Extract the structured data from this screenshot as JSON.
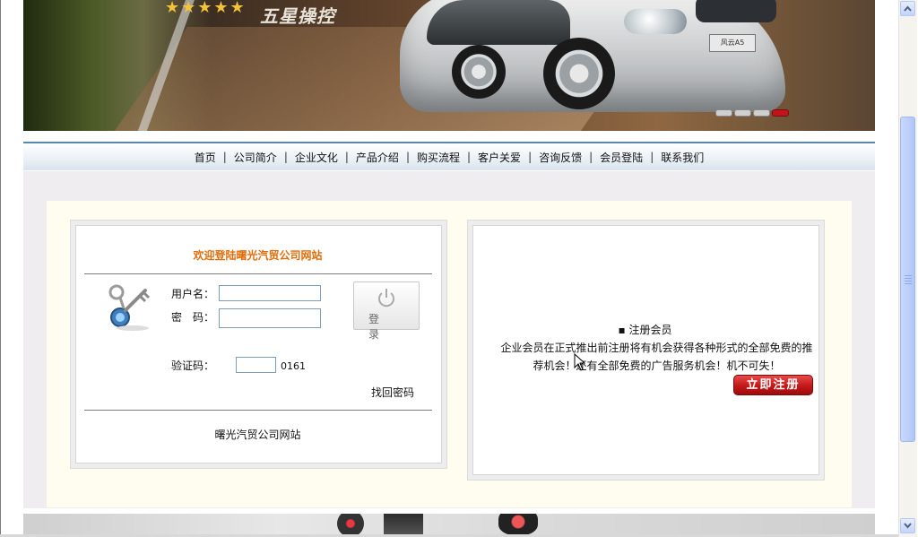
{
  "banner": {
    "stars": "★★★★★",
    "slogan": "五星操控",
    "plate_text": "风云A5",
    "slides_total": 4,
    "active_slide": 4
  },
  "nav": {
    "items": [
      "首页",
      "公司简介",
      "企业文化",
      "产品介绍",
      "购买流程",
      "客户关爱",
      "咨询反馈",
      "会员登陆",
      "联系我们"
    ]
  },
  "login": {
    "welcome": "欢迎登陆曙光汽贸公司网站",
    "username_label": "用户名：",
    "password_label": "密　码：",
    "captcha_label": "验证码：",
    "captcha_code": "0161",
    "username_value": "",
    "password_value": "",
    "captcha_value": "",
    "login_button": "登录",
    "find_password": "找回密码",
    "footer_site": "曙光汽贸公司网站"
  },
  "register": {
    "title": "▪ 注册会员",
    "text": "企业会员在正式推出前注册将有机会获得各种形式的全部免费的推荐机会！还有全部免费的广告服务机会！机不可失！",
    "button": "立即注册"
  },
  "colors": {
    "welcome_text": "#e36c09",
    "register_button": "#c31818",
    "nav_border": "#5b87b3",
    "active_dot": "#c3141b"
  }
}
